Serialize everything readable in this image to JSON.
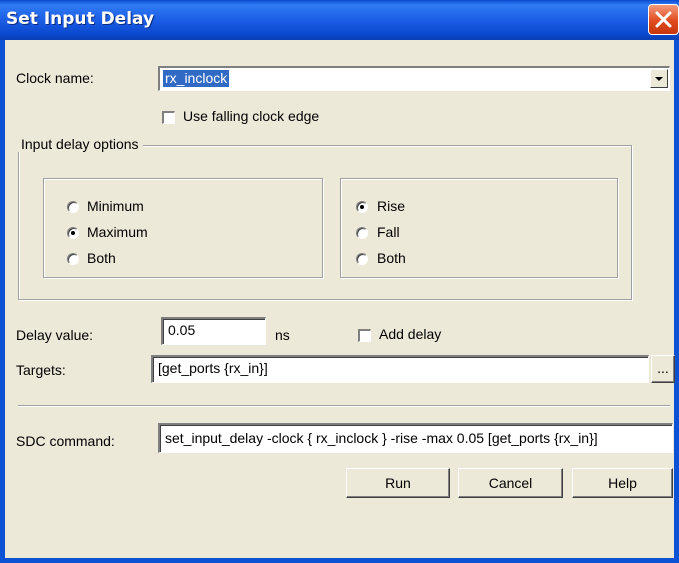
{
  "window": {
    "title": "Set Input Delay"
  },
  "clock": {
    "label": "Clock name:",
    "value": "rx_inclock"
  },
  "falling_edge": {
    "label": "Use falling clock edge",
    "checked": false
  },
  "input_delay_options": {
    "title": "Input delay options",
    "minmax": [
      {
        "label": "Minimum",
        "checked": false
      },
      {
        "label": "Maximum",
        "checked": true
      },
      {
        "label": "Both",
        "checked": false
      }
    ],
    "risefall": [
      {
        "label": "Rise",
        "checked": true
      },
      {
        "label": "Fall",
        "checked": false
      },
      {
        "label": "Both",
        "checked": false
      }
    ]
  },
  "delay": {
    "label": "Delay value:",
    "value": "0.05",
    "unit": "ns"
  },
  "add_delay": {
    "label": "Add delay",
    "checked": false
  },
  "targets": {
    "label": "Targets:",
    "value": "[get_ports {rx_in}]",
    "browse_label": "..."
  },
  "sdc": {
    "label": "SDC command:",
    "value": "set_input_delay -clock { rx_inclock } -rise -max 0.05 [get_ports {rx_in}]"
  },
  "buttons": {
    "run": "Run",
    "cancel": "Cancel",
    "help": "Help"
  },
  "colors": {
    "titlebar": "#0a4bd1",
    "window_bg": "#ece9d8",
    "selection": "#316ac5",
    "close_button": "#e14b1f"
  }
}
